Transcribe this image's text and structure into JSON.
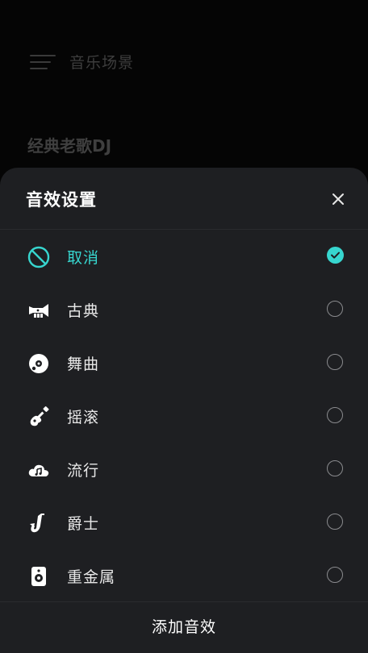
{
  "background": {
    "title": "音乐场景",
    "section_title": "经典老歌DJ"
  },
  "sheet": {
    "title": "音效设置",
    "options": [
      {
        "label": "取消",
        "icon": "disabled-icon",
        "selected": true
      },
      {
        "label": "古典",
        "icon": "trumpet-icon",
        "selected": false
      },
      {
        "label": "舞曲",
        "icon": "vinyl-disc-icon",
        "selected": false
      },
      {
        "label": "摇滚",
        "icon": "guitar-icon",
        "selected": false
      },
      {
        "label": "流行",
        "icon": "cloud-music-icon",
        "selected": false
      },
      {
        "label": "爵士",
        "icon": "saxophone-icon",
        "selected": false
      },
      {
        "label": "重金属",
        "icon": "speaker-icon",
        "selected": false
      }
    ],
    "footer_button": "添加音效"
  },
  "colors": {
    "accent": "#37d6cf",
    "sheet_bg": "#1e1f22",
    "text": "#e8e8e8"
  }
}
